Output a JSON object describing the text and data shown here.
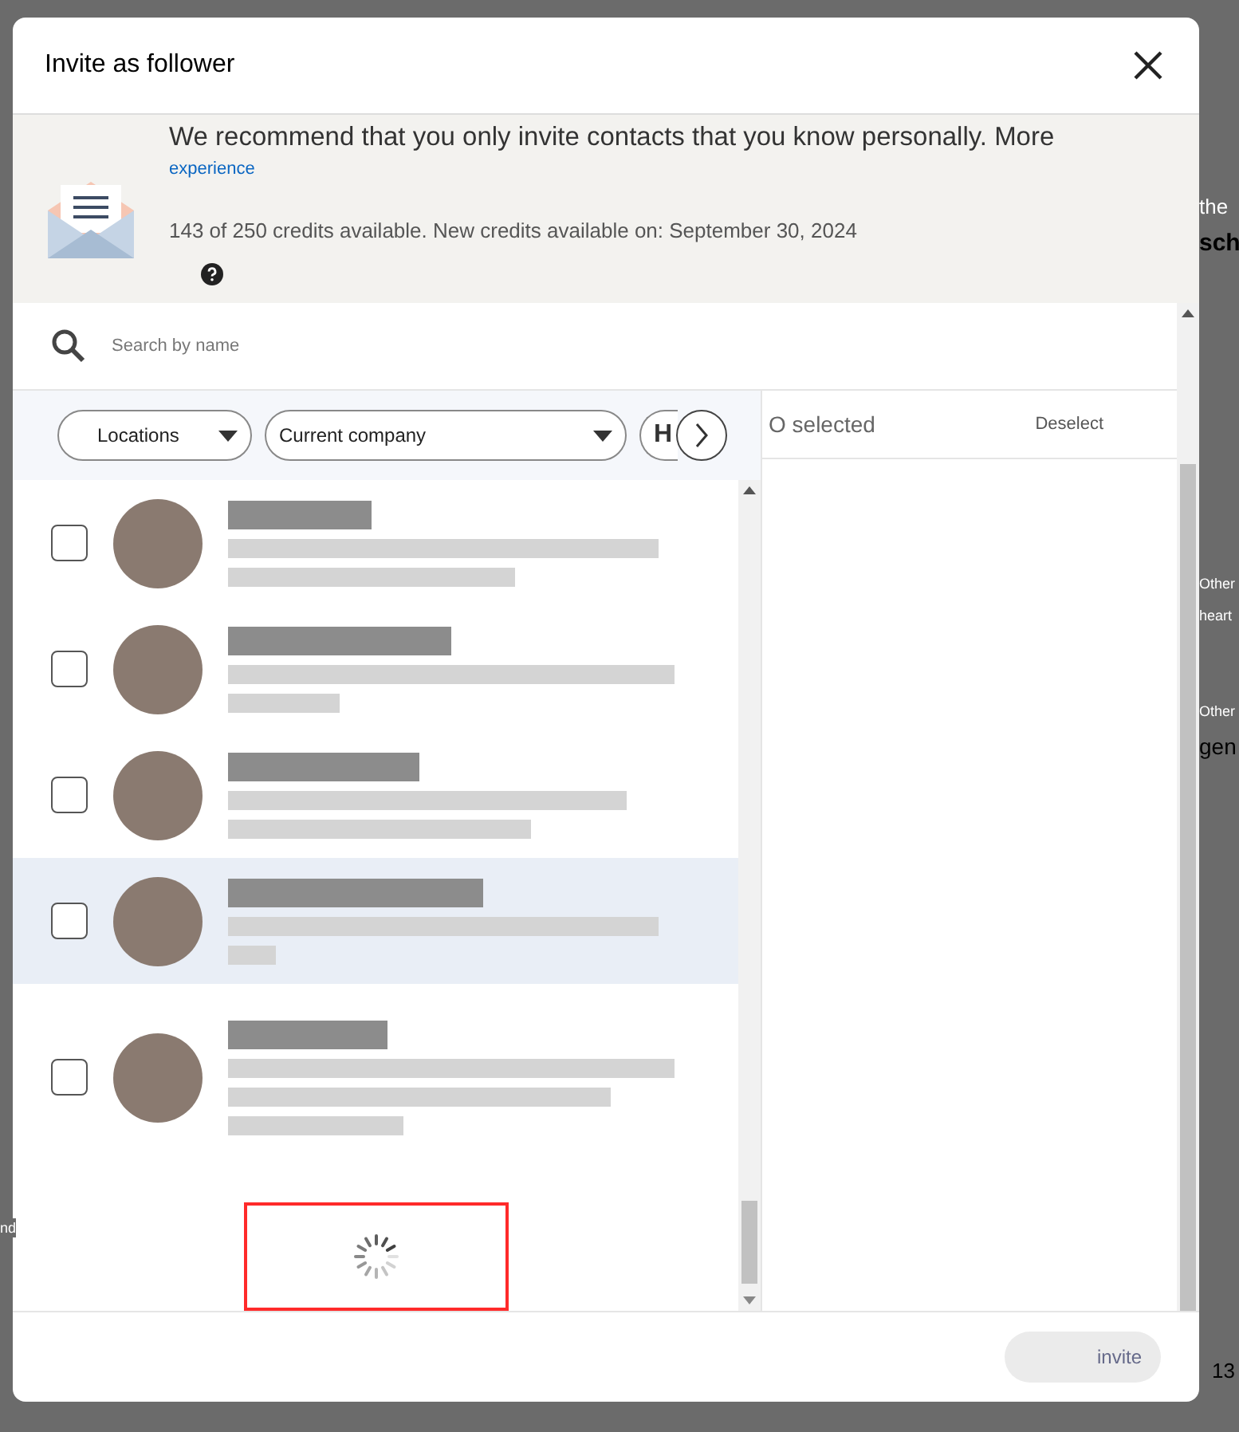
{
  "background_fragments": [
    {
      "text": "the"
    },
    {
      "text": "sch"
    },
    {
      "text": "Other"
    },
    {
      "text": "heart"
    },
    {
      "text": "Other"
    },
    {
      "text": "gen"
    },
    {
      "text": "13"
    },
    {
      "text": "nd"
    }
  ],
  "dialog": {
    "title": "Invite as follower",
    "notice": {
      "message": "We recommend that you only invite contacts that you know personally. More",
      "link": "experience",
      "credits": "143 of 250 credits available. New credits available on: September 30, 2024"
    },
    "search": {
      "placeholder": "Search by name"
    },
    "filters": [
      {
        "label": "Locations",
        "kind": "dropdown"
      },
      {
        "label": "Current company",
        "kind": "dropdown"
      },
      {
        "label": "H",
        "kind": "cut"
      }
    ],
    "selected_panel": {
      "count": "O selected",
      "action": "Deselect"
    },
    "contacts": [
      {
        "checked": false,
        "highlighted": false
      },
      {
        "checked": false,
        "highlighted": false
      },
      {
        "checked": false,
        "highlighted": false
      },
      {
        "checked": false,
        "highlighted": true
      },
      {
        "checked": false,
        "highlighted": false
      }
    ],
    "loading": true,
    "invite_button": {
      "label": "invite",
      "disabled": true
    }
  }
}
